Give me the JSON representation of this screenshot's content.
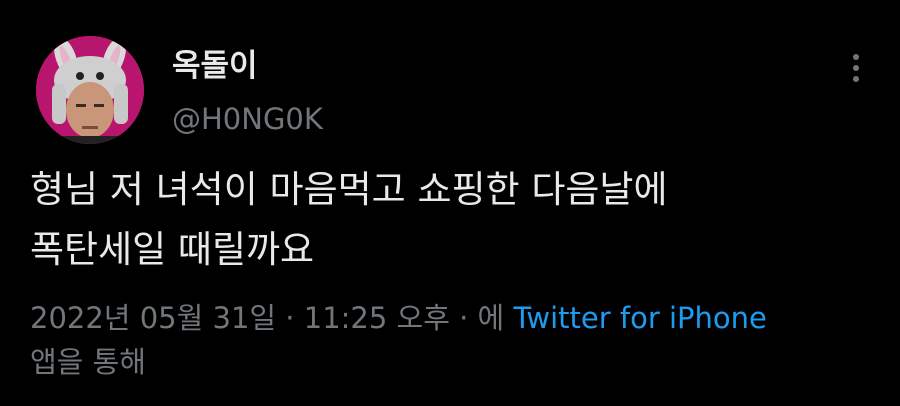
{
  "tweet": {
    "display_name": "옥돌이",
    "handle": "@H0NG0K",
    "text_line1": "형님 저 녀석이 마음먹고 쇼핑한 다음날에",
    "text_line2": "폭탄세일 때릴까요",
    "timestamp": "2022년 05월 31일 · 11:25 오후 · 에",
    "source": "Twitter for iPhone",
    "source_suffix": "앱을 통해"
  },
  "icons": {
    "more": "more-vertical-icon",
    "avatar": "avatar-image"
  },
  "colors": {
    "background": "#000000",
    "text_primary": "#e7e9ea",
    "text_secondary": "#71767b",
    "link": "#1d9bf0",
    "avatar_bg": "#c2187a"
  }
}
